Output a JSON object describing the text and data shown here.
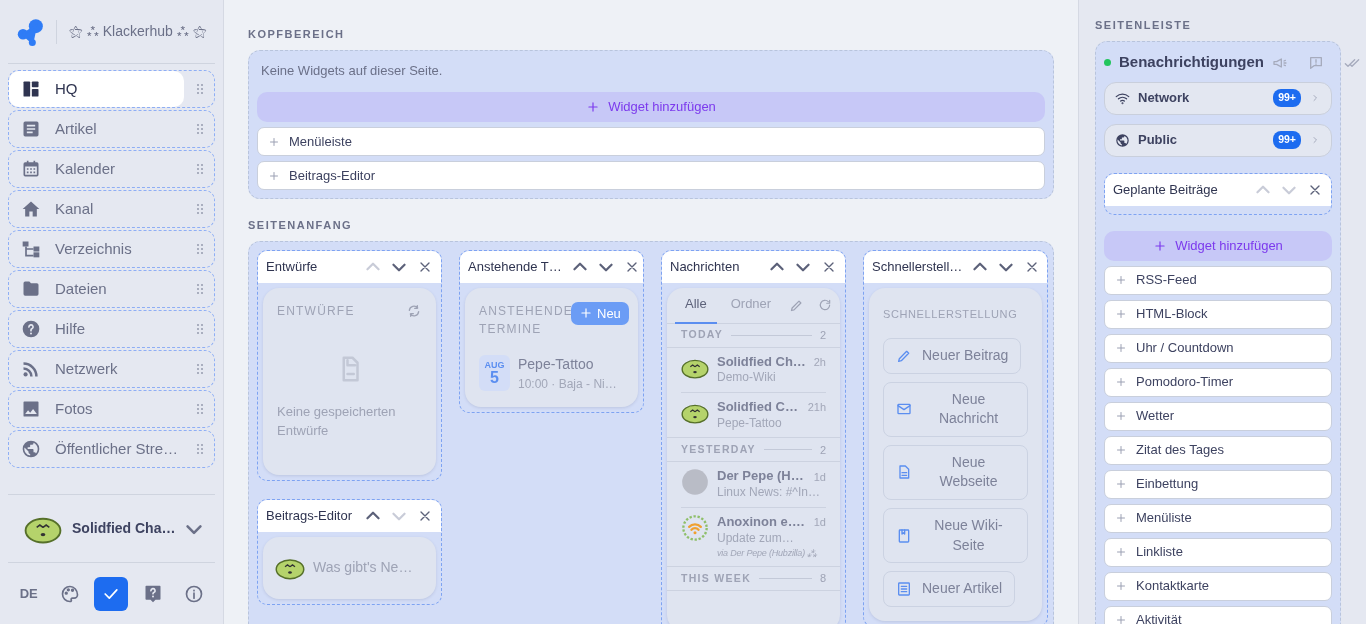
{
  "brand": {
    "title": "⚝ ⁂ Klackerhub ⁂ ⚝"
  },
  "nav": [
    {
      "label": "HQ",
      "selected": true
    },
    {
      "label": "Artikel",
      "selected": false
    },
    {
      "label": "Kalender",
      "selected": false
    },
    {
      "label": "Kanal",
      "selected": false
    },
    {
      "label": "Verzeichnis",
      "selected": false
    },
    {
      "label": "Dateien",
      "selected": false
    },
    {
      "label": "Hilfe",
      "selected": false
    },
    {
      "label": "Netzwerk",
      "selected": false
    },
    {
      "label": "Fotos",
      "selected": false
    },
    {
      "label": "Öffentlicher Stre…",
      "selected": false
    }
  ],
  "account": {
    "name": "Solidfied Cha…"
  },
  "footer_buttons": [
    {
      "kind": "language",
      "label": "DE",
      "selected": false
    },
    {
      "kind": "palette",
      "selected": false
    },
    {
      "kind": "check",
      "selected": true
    },
    {
      "kind": "help",
      "selected": false
    },
    {
      "kind": "info",
      "selected": false
    }
  ],
  "header_area": {
    "title": "KOPFBEREICH",
    "empty_note": "Keine Widgets auf dieser Seite.",
    "add_button": "Widget hinzufügen",
    "options": [
      "Menüleiste",
      "Beitrags-Editor"
    ]
  },
  "top_area": {
    "title": "SEITENANFANG",
    "columns": [
      [
        {
          "kind": "drafts",
          "title": "Entwürfe",
          "up_disabled": true,
          "down_disabled": false,
          "heading": "ENTWÜRFE",
          "empty_note": "Keine gespeicherten Entwürfe"
        },
        {
          "kind": "editor",
          "title": "Beitrags-Editor",
          "up_disabled": false,
          "down_disabled": true,
          "placeholder": "Was gibt's Ne…"
        }
      ],
      [
        {
          "kind": "events",
          "title": "Anstehende T…",
          "up_disabled": false,
          "down_disabled": false,
          "heading": "ANSTEHENDE TERMINE",
          "new_button": "Neu",
          "events": [
            {
              "month": "AUG",
              "day": "5",
              "title": "Pepe-Tattoo",
              "detail": "10:00 · Baja - Ni…"
            }
          ]
        }
      ],
      [
        {
          "kind": "messages",
          "title": "Nachrichten",
          "up_disabled": false,
          "down_disabled": false,
          "tabs": [
            {
              "label": "Alle",
              "selected": true
            },
            {
              "label": "Ordner",
              "selected": false
            }
          ],
          "groups": [
            {
              "label": "TODAY",
              "count": "2",
              "items": [
                {
                  "kind": "lime",
                  "name": "Solidfied Ch…",
                  "time": "2h",
                  "text": "Demo-Wiki"
                },
                {
                  "kind": "lime",
                  "name": "Solidfied C…",
                  "time": "21h",
                  "text": "Pepe-Tattoo"
                }
              ]
            },
            {
              "label": "YESTERDAY",
              "count": "2",
              "items": [
                {
                  "kind": "photo",
                  "name": "Der Pepe (H…",
                  "time": "1d",
                  "text": "Linux News: #^In…"
                },
                {
                  "kind": "logo",
                  "name": "Anoxinon e….",
                  "time": "1d",
                  "text": "Update zum…",
                  "via": "via Der Pepe (Hubzilla) ⁂"
                }
              ]
            },
            {
              "label": "THIS WEEK",
              "count": "8"
            }
          ]
        }
      ],
      [
        {
          "kind": "quick",
          "title": "Schnellerstell…",
          "up_disabled": false,
          "down_disabled": false,
          "heading": "SCHNELLERSTELLUNG",
          "buttons": [
            "Neuer Beitrag",
            "Neue Nachricht",
            "Neue Webseite",
            "Neue Wiki-Seite",
            "Neuer Artikel"
          ]
        }
      ]
    ]
  },
  "sidebar": {
    "title": "SEITENLEISTE",
    "notifications": {
      "title": "Benachrichtigungen",
      "online": true,
      "channels": [
        {
          "label": "Network",
          "count": "99+"
        },
        {
          "label": "Public",
          "count": "99+"
        }
      ]
    },
    "widgets": [
      {
        "title": "Geplante Beiträge",
        "up_disabled": true,
        "down_disabled": true
      }
    ],
    "add_button": "Widget hinzufügen",
    "options": [
      "RSS-Feed",
      "HTML-Block",
      "Uhr / Countdown",
      "Pomodoro-Timer",
      "Wetter",
      "Zitat des Tages",
      "Einbettung",
      "Menüliste",
      "Linkliste",
      "Kontaktkarte",
      "Aktivität"
    ]
  }
}
